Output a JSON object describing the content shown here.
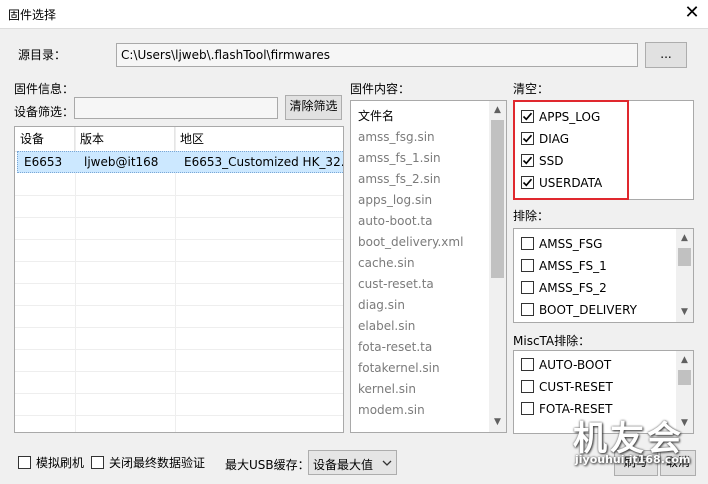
{
  "window": {
    "title": "固件选择",
    "close_glyph": "✕"
  },
  "source": {
    "label": "源目录：",
    "path": "C:\\Users\\ljweb\\.flashTool\\firmwares",
    "browse_label": "..."
  },
  "firmware_info": {
    "label": "固件信息：",
    "filter_label": "设备筛选：",
    "filter_value": "",
    "clear_filter_label": "清除筛选",
    "columns": [
      "设备",
      "版本",
      "地区"
    ],
    "rows": [
      {
        "device": "E6653",
        "version": "ljweb@it168",
        "region": "E6653_Customized HK_32...."
      }
    ]
  },
  "firmware_content": {
    "label": "固件内容：",
    "header": "文件名",
    "files": [
      "amss_fsg.sin",
      "amss_fs_1.sin",
      "amss_fs_2.sin",
      "apps_log.sin",
      "auto-boot.ta",
      "boot_delivery.xml",
      "cache.sin",
      "cust-reset.ta",
      "diag.sin",
      "elabel.sin",
      "fota-reset.ta",
      "fotakernel.sin",
      "kernel.sin",
      "modem.sin"
    ]
  },
  "wipe": {
    "label": "清空：",
    "items": [
      {
        "label": "APPS_LOG",
        "checked": true
      },
      {
        "label": "DIAG",
        "checked": true
      },
      {
        "label": "SSD",
        "checked": true
      },
      {
        "label": "USERDATA",
        "checked": true
      }
    ],
    "highlight_color": "#e0282e"
  },
  "exclude": {
    "label": "排除：",
    "items": [
      {
        "label": "AMSS_FSG",
        "checked": false
      },
      {
        "label": "AMSS_FS_1",
        "checked": false
      },
      {
        "label": "AMSS_FS_2",
        "checked": false
      },
      {
        "label": "BOOT_DELIVERY",
        "checked": false
      }
    ]
  },
  "miscta_exclude": {
    "label": "MiscTA排除：",
    "items": [
      {
        "label": "AUTO-BOOT",
        "checked": false
      },
      {
        "label": "CUST-RESET",
        "checked": false
      },
      {
        "label": "FOTA-RESET",
        "checked": false
      }
    ]
  },
  "footer": {
    "simulate_label": "模拟刷机",
    "simulate_checked": false,
    "disable_verify_label": "关闭最终数据验证",
    "disable_verify_checked": false,
    "usb_buffer_label": "最大USB缓存：",
    "usb_buffer_value": "设备最大值",
    "flash_label": "刷写",
    "cancel_label": "取消"
  },
  "watermark": {
    "text": "机友会",
    "url": "jiyouhui.it168.com"
  },
  "icons": {
    "check": "check-icon",
    "dropdown": "chevron-down-icon",
    "scroll_up": "scroll-up-icon",
    "scroll_down": "scroll-down-icon"
  },
  "colors": {
    "selection": "#cce8ff",
    "disabled_text": "#7b7b7b"
  }
}
